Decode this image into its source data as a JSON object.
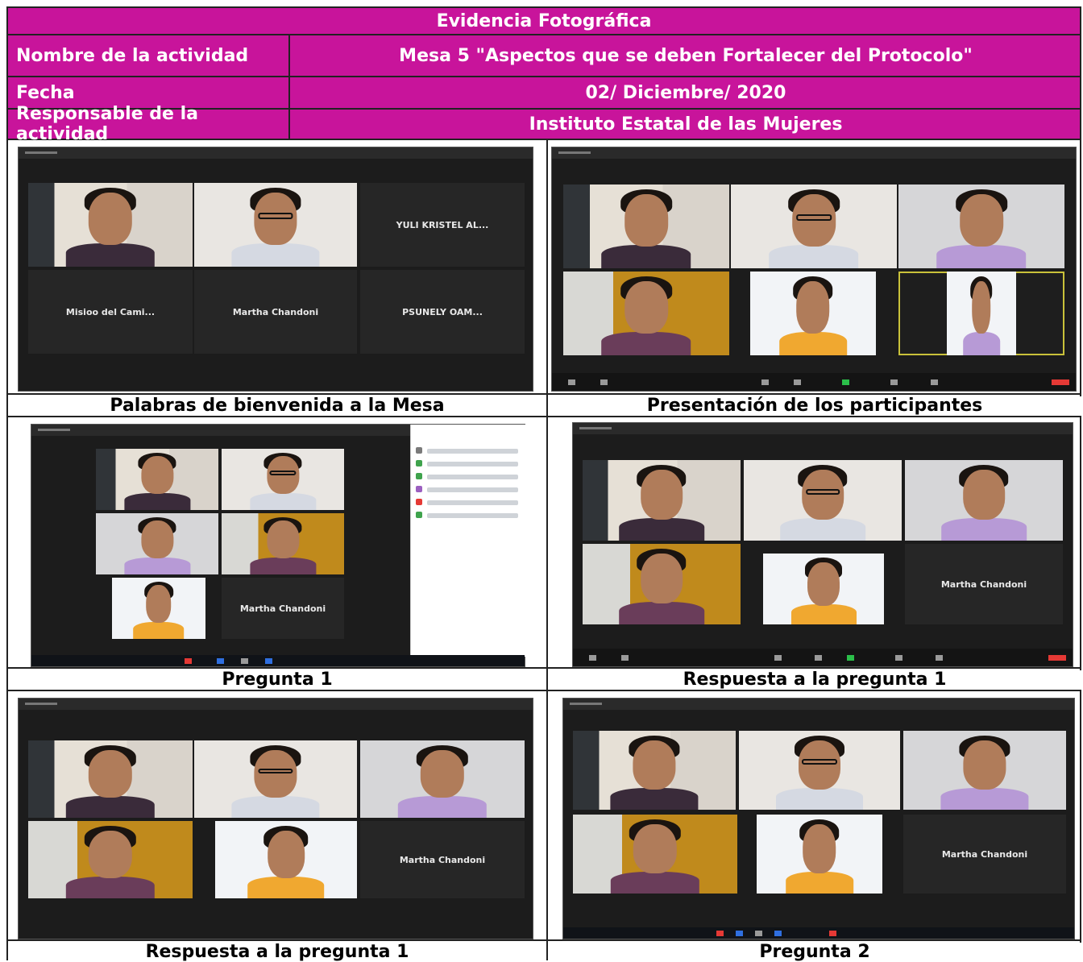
{
  "header": {
    "title": "Evidencia Fotográfica",
    "rows": [
      {
        "label": "Nombre de la actividad",
        "value": "Mesa 5 \"Aspectos que se deben Fortalecer del Protocolo\""
      },
      {
        "label": "Fecha",
        "value": "02/ Diciembre/ 2020"
      },
      {
        "label": "Responsable de la actividad",
        "value": "Instituto Estatal de las Mujeres"
      }
    ]
  },
  "photos": [
    {
      "caption": "Palabras de bienvenida a la Mesa",
      "names": [
        "YULI KRISTEL AL...",
        "Misioo del Cami...",
        "Martha Chandoni",
        "PSUNELY OAM..."
      ]
    },
    {
      "caption": "Presentación de los participantes"
    },
    {
      "caption": "Pregunta 1",
      "names": [
        "Martha Chandoni"
      ]
    },
    {
      "caption": "Respuesta a la pregunta 1",
      "names": [
        "Martha Chandoni"
      ]
    },
    {
      "caption": "Respuesta a la pregunta 1",
      "names": [
        "Martha Chandoni"
      ]
    },
    {
      "caption": "Pregunta  2",
      "names": [
        "Martha Chandoni"
      ]
    }
  ],
  "colors": {
    "header_bg": "#c8149b",
    "header_text": "#ffffff",
    "zoom_bg": "#1c1c1c"
  }
}
